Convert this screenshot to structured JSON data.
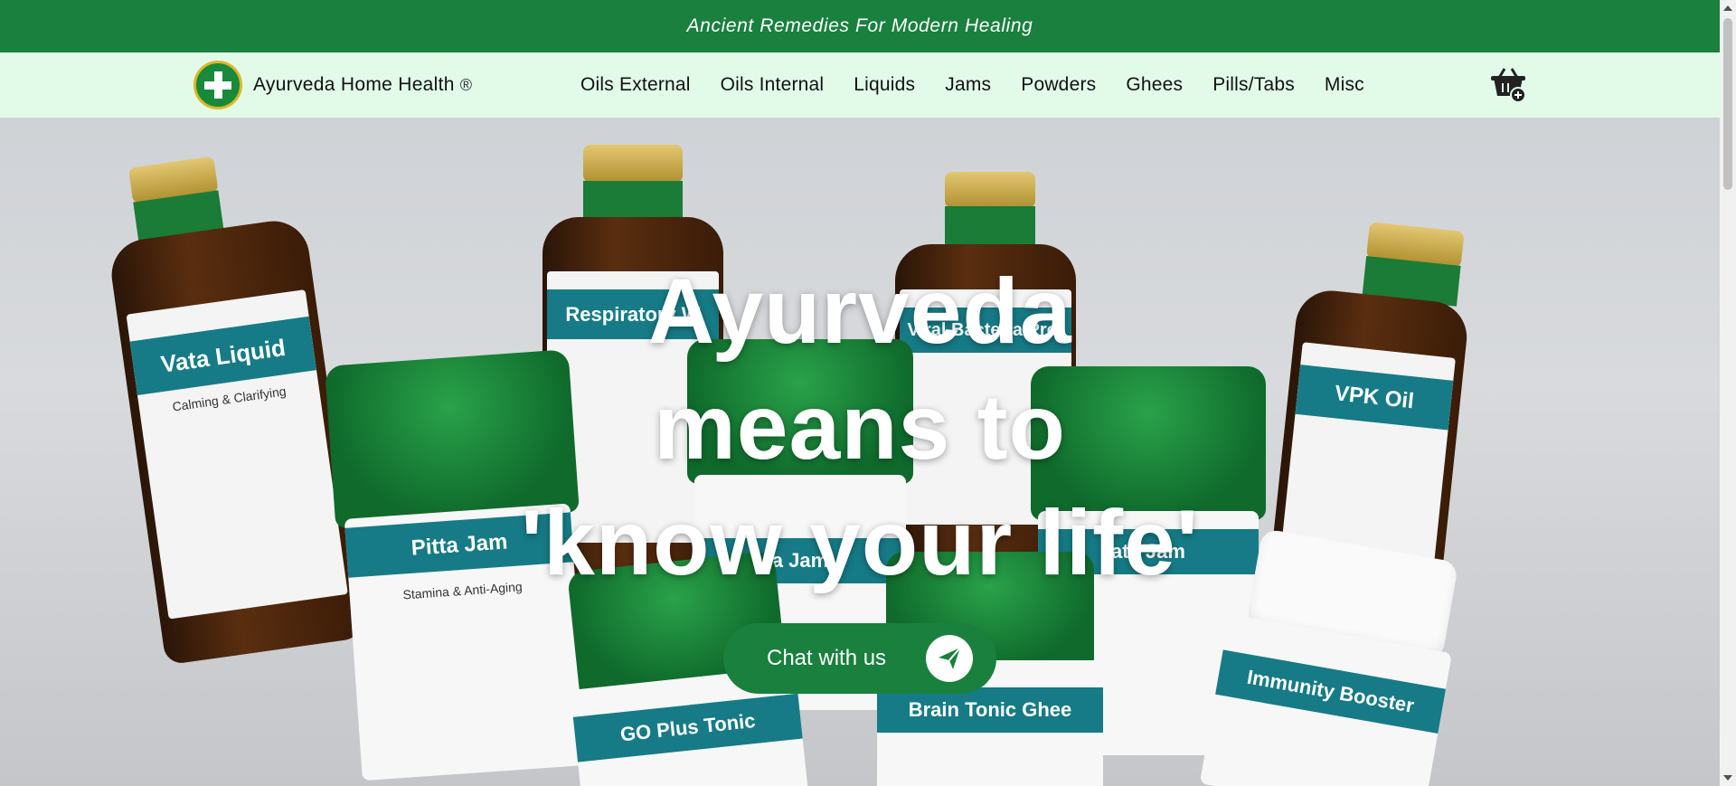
{
  "announcement": "Ancient Remedies For Modern Healing",
  "brand": {
    "name": "Ayurveda Home Health",
    "registered": "®",
    "logo_icon": "medical-cross-icon"
  },
  "nav": {
    "items": [
      "Oils External",
      "Oils Internal",
      "Liquids",
      "Jams",
      "Powders",
      "Ghees",
      "Pills/Tabs",
      "Misc"
    ],
    "cart_icon": "cart-add-icon"
  },
  "hero": {
    "lines": [
      "Ayurveda",
      "means to",
      "'know your life'"
    ],
    "cta_label": "Chat with us",
    "cta_icon": "send-icon",
    "products": {
      "vata": "Vata Liquid",
      "vata_sub": "Calming & Clarifying",
      "respiratory": "Respiratory W",
      "viral": "Viral Bacteria Prot",
      "vpk": "VPK Oil",
      "pitta": "Pitta Jam",
      "pitta_sub": "Stamina & Anti-Aging",
      "jam_mid": "a Jam",
      "jam_right": "ata Jam",
      "goplus": "GO Plus Tonic",
      "brain": "Brain Tonic Ghee",
      "immunity": "Immunity Booster"
    }
  },
  "colors": {
    "brand_green": "#19803e",
    "nav_bg": "#e1fbe8",
    "label_teal": "#167b86"
  }
}
